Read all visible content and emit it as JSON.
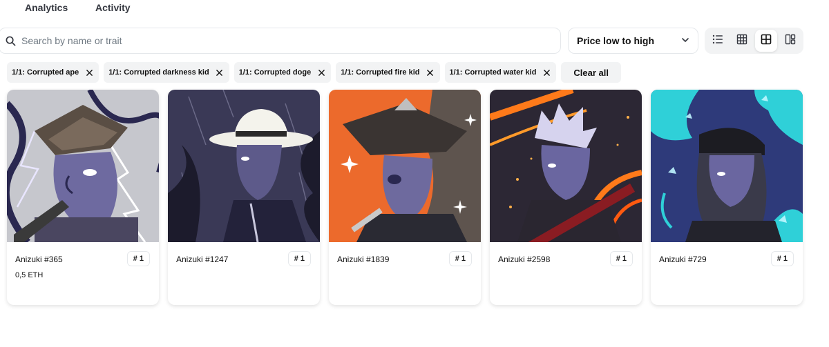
{
  "tabs": [
    {
      "label": "Analytics"
    },
    {
      "label": "Activity"
    }
  ],
  "search": {
    "placeholder": "Search by name or trait",
    "value": ""
  },
  "sort": {
    "label": "Price low to high"
  },
  "view_modes": [
    "list-icon",
    "grid-small-icon",
    "grid-large-icon",
    "masonry-icon"
  ],
  "active_view": "grid-large-icon",
  "filters": [
    {
      "label": "1/1: Corrupted ape"
    },
    {
      "label": "1/1: Corrupted darkness kid"
    },
    {
      "label": "1/1: Corrupted doge"
    },
    {
      "label": "1/1: Corrupted fire kid"
    },
    {
      "label": "1/1: Corrupted water kid"
    }
  ],
  "clear_all_label": "Clear all",
  "items": [
    {
      "name": "Anizuki #365",
      "rank": "# 1",
      "price": "0,5 ETH",
      "art_bg": "#c9c9cf"
    },
    {
      "name": "Anizuki #1247",
      "rank": "# 1",
      "price": "",
      "art_bg": "#3d3c5a"
    },
    {
      "name": "Anizuki #1839",
      "rank": "# 1",
      "price": "",
      "art_bg": "#ec6a2c"
    },
    {
      "name": "Anizuki #2598",
      "rank": "# 1",
      "price": "",
      "art_bg": "#2e2a38"
    },
    {
      "name": "Anizuki #729",
      "rank": "# 1",
      "price": "",
      "art_bg": "#2d3a7a"
    }
  ],
  "colors": {
    "border": "#e5e8eb",
    "chip_bg": "#f2f3f4",
    "text": "#121212"
  }
}
